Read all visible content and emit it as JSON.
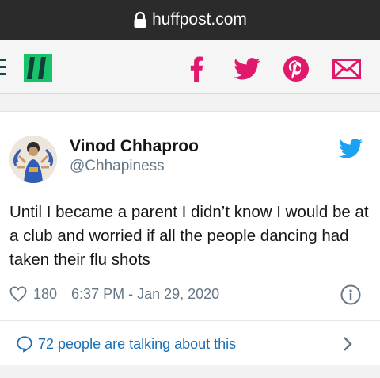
{
  "browser": {
    "url": "huffpost.com",
    "lock_icon": "lock-icon"
  },
  "site": {
    "logo_icon": "huffpost-logo-icon",
    "menu_icon": "hamburger-menu-icon",
    "share_icons": [
      "facebook-icon",
      "twitter-icon",
      "pinterest-icon",
      "email-icon"
    ],
    "accent_color": "#e0196d",
    "logo_color": "#18c36b"
  },
  "tweet": {
    "author_name": "Vinod Chhaproo",
    "author_handle": "@Chhapiness",
    "text": "Until I became a parent I didn’t know I would be at a club and worried if all the people dancing had taken their flu shots",
    "likes": "180",
    "timestamp": "6:37 PM - Jan 29, 2020",
    "conversation": "72 people are talking about this",
    "brand_color": "#1da1f2",
    "link_color": "#1b6fb4"
  }
}
